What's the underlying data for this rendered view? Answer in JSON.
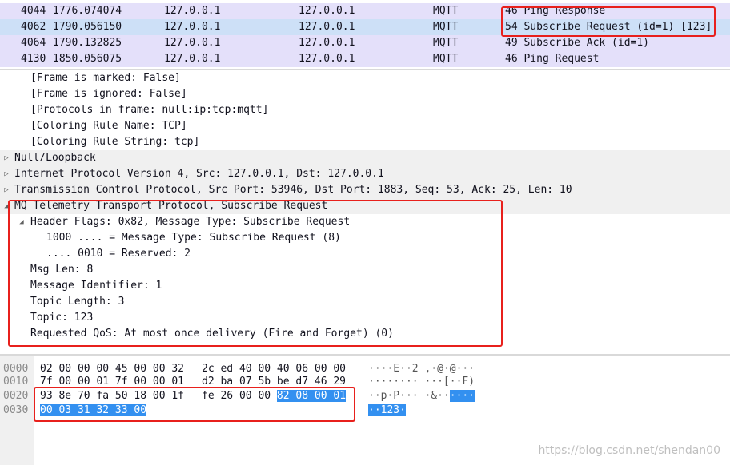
{
  "packet_list": {
    "rows": [
      {
        "no": "4044",
        "time": "1776.074074",
        "src": "127.0.0.1",
        "dst": "127.0.0.1",
        "proto": "MQTT",
        "info": "46 Ping Response",
        "selected": false
      },
      {
        "no": "4062",
        "time": "1790.056150",
        "src": "127.0.0.1",
        "dst": "127.0.0.1",
        "proto": "MQTT",
        "info": "54 Subscribe Request (id=1) [123]",
        "selected": true
      },
      {
        "no": "4064",
        "time": "1790.132825",
        "src": "127.0.0.1",
        "dst": "127.0.0.1",
        "proto": "MQTT",
        "info": "49 Subscribe Ack (id=1)",
        "selected": false
      },
      {
        "no": "4130",
        "time": "1850.056075",
        "src": "127.0.0.1",
        "dst": "127.0.0.1",
        "proto": "MQTT",
        "info": "46 Ping Request",
        "selected": false
      }
    ]
  },
  "details": {
    "frame_lines": [
      "[Frame is marked: False]",
      "[Frame is ignored: False]",
      "[Protocols in frame: null:ip:tcp:mqtt]",
      "[Coloring Rule Name: TCP]",
      "[Coloring Rule String: tcp]"
    ],
    "null_loopback": "Null/Loopback",
    "ip": "Internet Protocol Version 4, Src: 127.0.0.1, Dst: 127.0.0.1",
    "tcp": "Transmission Control Protocol, Src Port: 53946, Dst Port: 1883, Seq: 53, Ack: 25, Len: 10",
    "mqtt": {
      "title": "MQ Telemetry Transport Protocol, Subscribe Request",
      "header_flags": "Header Flags: 0x82, Message Type: Subscribe Request",
      "msg_type_bits": "1000 .... = Message Type: Subscribe Request (8)",
      "reserved_bits": ".... 0010 = Reserved: 2",
      "msg_len": "Msg Len: 8",
      "msg_id": "Message Identifier: 1",
      "topic_len": "Topic Length: 3",
      "topic": "Topic: 123",
      "qos": "Requested QoS: At most once delivery (Fire and Forget) (0)"
    }
  },
  "bytes": {
    "rows": [
      {
        "offset": "0000",
        "hex_a": "02 00 00 00 45 00 00 32",
        "hex_b": "2c ed 40 00 40 06 00 00",
        "ascii": "····E··2 ,·@·@···"
      },
      {
        "offset": "0010",
        "hex_a": "7f 00 00 01 7f 00 00 01",
        "hex_b": "d2 ba 07 5b be d7 46 29",
        "ascii": "········ ···[··F)"
      },
      {
        "offset": "0020",
        "hex_a": "93 8e 70 fa 50 18 00 1f",
        "hex_b_plain": "fe 26 00 00 ",
        "hex_b_hl": "82 08 00 01",
        "ascii_plain": "··p·P··· ·&··",
        "ascii_hl": "····"
      },
      {
        "offset": "0030",
        "hex_hl": "00 03 31 32 33 00",
        "ascii_hl": "··123·"
      }
    ]
  },
  "watermark": "https://blog.csdn.net/shendan00"
}
